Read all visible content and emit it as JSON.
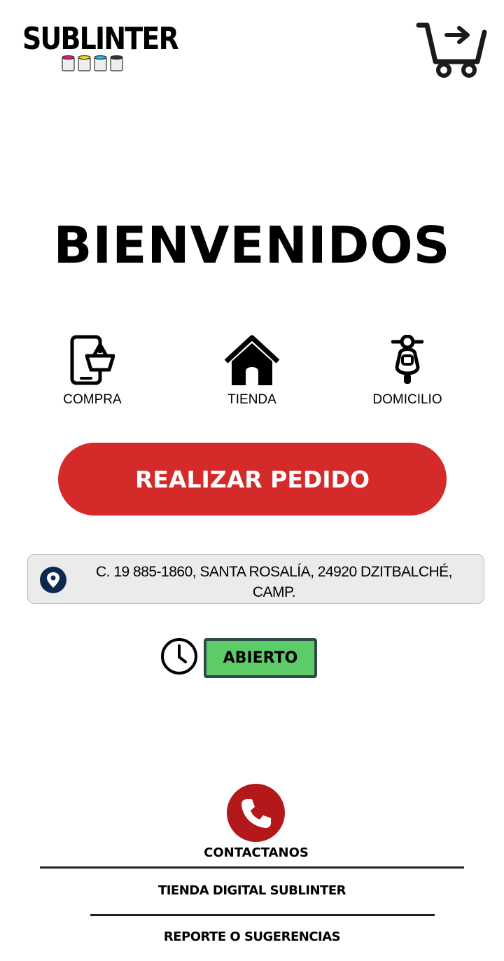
{
  "header": {
    "logo_text": "SUBLINTER",
    "logo_icon": "paint-cans-logo",
    "cart_icon": "cart-arrow-icon"
  },
  "welcome_title": "BIENVENIDOS",
  "features": [
    {
      "label": "COMPRA",
      "icon": "phone-basket-icon"
    },
    {
      "label": "TIENDA",
      "icon": "house-icon"
    },
    {
      "label": "DOMICILIO",
      "icon": "scooter-icon"
    }
  ],
  "order_button_label": "REALIZAR PEDIDO",
  "address": {
    "text": "C. 19 885-1860, SANTA ROSALÍA, 24920 DZITBALCHÉ, CAMP.",
    "icon": "location-pin-icon"
  },
  "status": {
    "label": "ABIERTO",
    "icon": "clock-icon"
  },
  "footer": {
    "contact_label": "CONTACTANOS",
    "contact_icon": "phone-icon",
    "links": [
      "TIENDA DIGITAL SUBLINTER",
      "REPORTE O SUGERENCIAS"
    ]
  },
  "colors": {
    "primary_red": "#d52a2a",
    "phone_red": "#b3181b",
    "open_green": "#5dcb67",
    "address_bg": "#ebebeb",
    "pin_blue": "#0d2a4e"
  }
}
